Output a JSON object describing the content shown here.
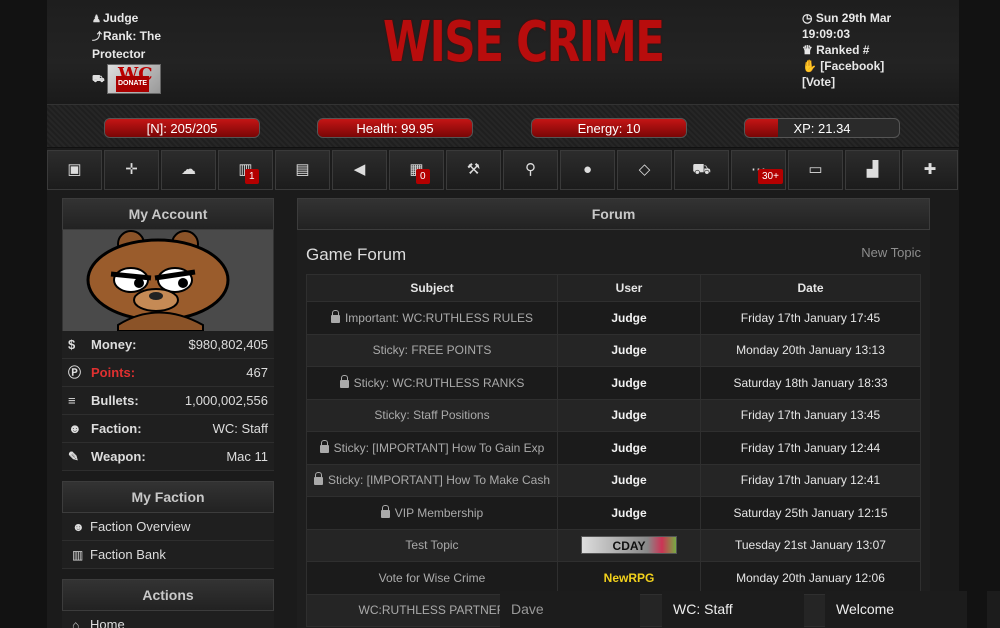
{
  "header": {
    "user": "Judge",
    "rank_line1": "Rank: The",
    "rank_line2": "Protector",
    "donate_logo": "WC",
    "donate_text": "DONATE",
    "logo": "WISE CRIME",
    "date_line1": "Sun 29th Mar",
    "time": "19:09:03",
    "ranked": "Ranked #",
    "facebook": "[Facebook]",
    "vote": "[Vote]"
  },
  "stats": [
    {
      "label": "[N]: 205/205",
      "fill": 1.0
    },
    {
      "label": "Health: 99.95",
      "fill": 1.0
    },
    {
      "label": "Energy: 10",
      "fill": 1.0
    },
    {
      "label": "XP: 21.34",
      "fill": 0.2134
    }
  ],
  "nav": [
    {
      "icon": "money-icon",
      "glyph": "▣",
      "badge": ""
    },
    {
      "icon": "crosshair-icon",
      "glyph": "✛",
      "badge": ""
    },
    {
      "icon": "chat-icon",
      "glyph": "☁",
      "badge": ""
    },
    {
      "icon": "jail-icon",
      "glyph": "▥",
      "badge": "1"
    },
    {
      "icon": "save-icon",
      "glyph": "▤",
      "badge": ""
    },
    {
      "icon": "megaphone-icon",
      "glyph": "◀",
      "badge": ""
    },
    {
      "icon": "inbox-icon",
      "glyph": "▦",
      "badge": "0"
    },
    {
      "icon": "gavel-icon",
      "glyph": "⚒",
      "badge": ""
    },
    {
      "icon": "search-icon",
      "glyph": "⚲",
      "badge": ""
    },
    {
      "icon": "globe-icon",
      "glyph": "●",
      "badge": ""
    },
    {
      "icon": "diamond-icon",
      "glyph": "◇",
      "badge": ""
    },
    {
      "icon": "car-icon",
      "glyph": "⛟",
      "badge": ""
    },
    {
      "icon": "events-icon",
      "glyph": "⋯",
      "badge": "30+"
    },
    {
      "icon": "id-card-icon",
      "glyph": "▭",
      "badge": ""
    },
    {
      "icon": "factory-icon",
      "glyph": "▟",
      "badge": ""
    },
    {
      "icon": "gift-icon",
      "glyph": "✚",
      "badge": ""
    }
  ],
  "account": {
    "title": "My Account",
    "rows": [
      {
        "icon": "dollar-icon",
        "glyph": "$",
        "label": "Money:",
        "value": "$980,802,405",
        "label_color": "#dddddd"
      },
      {
        "icon": "points-icon",
        "glyph": "Ⓟ",
        "label": "Points:",
        "value": "467",
        "label_color": "#e03030"
      },
      {
        "icon": "bullets-icon",
        "glyph": "≡",
        "label": "Bullets:",
        "value": "1,000,002,556",
        "label_color": "#dddddd"
      },
      {
        "icon": "faction-icon",
        "glyph": "☻",
        "label": "Faction:",
        "value": "WC: Staff",
        "label_color": "#dddddd"
      },
      {
        "icon": "weapon-icon",
        "glyph": "✎",
        "label": "Weapon:",
        "value": "Mac 11",
        "label_color": "#dddddd"
      }
    ]
  },
  "faction": {
    "title": "My Faction",
    "links": [
      {
        "icon": "users-icon",
        "glyph": "☻",
        "label": "Faction Overview"
      },
      {
        "icon": "bank-icon",
        "glyph": "▥",
        "label": "Faction Bank"
      }
    ]
  },
  "actions": {
    "title": "Actions",
    "links": [
      {
        "icon": "home-icon",
        "glyph": "⌂",
        "label": "Home"
      }
    ]
  },
  "forum": {
    "panel_title": "Forum",
    "title": "Game Forum",
    "new_topic": "New Topic",
    "columns": [
      "Subject",
      "User",
      "Date"
    ],
    "rows": [
      {
        "locked": true,
        "subject": "Important: WC:RUTHLESS RULES",
        "user": "Judge",
        "date": "Friday 17th January 17:45"
      },
      {
        "locked": false,
        "subject": "Sticky: FREE POINTS",
        "user": "Judge",
        "date": "Monday 20th January 13:13"
      },
      {
        "locked": true,
        "subject": "Sticky: WC:RUTHLESS RANKS",
        "user": "Judge",
        "date": "Saturday 18th January 18:33"
      },
      {
        "locked": false,
        "subject": "Sticky: Staff Positions",
        "user": "Judge",
        "date": "Friday 17th January 13:45"
      },
      {
        "locked": true,
        "subject": "Sticky: [IMPORTANT] How To Gain Exp",
        "user": "Judge",
        "date": "Friday 17th January 12:44"
      },
      {
        "locked": true,
        "subject": "Sticky: [IMPORTANT] How To Make Cash",
        "user": "Judge",
        "date": "Friday 17th January 12:41"
      },
      {
        "locked": true,
        "subject": "VIP Membership",
        "user": "Judge",
        "date": "Saturday 25th January 12:15"
      },
      {
        "locked": false,
        "subject": "Test Topic",
        "user": "CDAY",
        "user_banner": true,
        "date": "Tuesday 21st January 13:07"
      },
      {
        "locked": false,
        "subject": "Vote for Wise Crime",
        "user": "NewRPG",
        "user_yellow": true,
        "date": "Monday 20th January 12:06"
      },
      {
        "locked": false,
        "subject": "WC:RUTHLESS PARTNER",
        "user": "",
        "date": ""
      }
    ]
  },
  "chat_tabs": [
    "Dave",
    "WC: Staff",
    "Welcome"
  ]
}
